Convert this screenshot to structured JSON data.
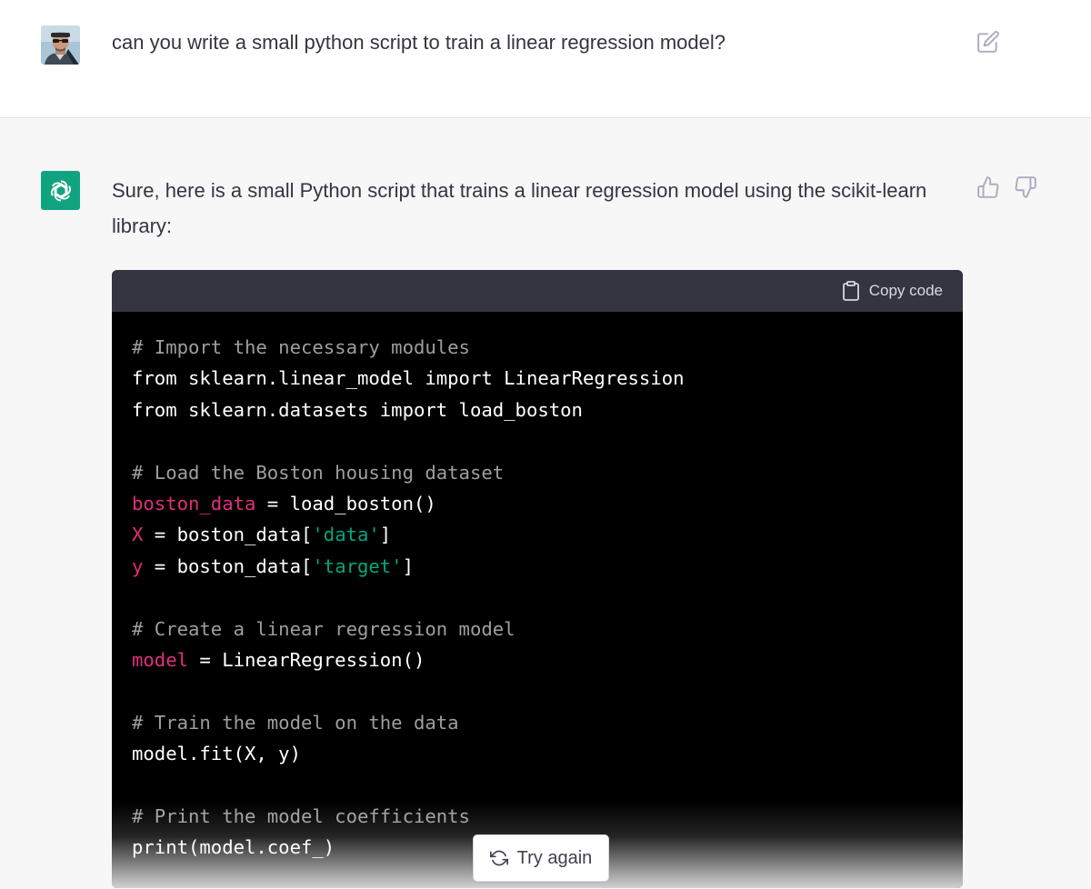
{
  "conversation": {
    "user_message": "can you write a small python script to train a linear regression model?",
    "assistant_intro": "Sure, here is a small Python script that trains a linear regression model using the scikit-learn library:"
  },
  "code_block": {
    "copy_label": "Copy code",
    "lines": [
      [
        {
          "t": "# Import the necessary modules",
          "k": "comment"
        }
      ],
      [
        {
          "t": "from sklearn.linear_model import LinearRegression",
          "k": "plain"
        }
      ],
      [
        {
          "t": "from sklearn.datasets import load_boston",
          "k": "plain"
        }
      ],
      [],
      [
        {
          "t": "# Load the Boston housing dataset",
          "k": "comment"
        }
      ],
      [
        {
          "t": "boston_data",
          "k": "var"
        },
        {
          "t": " = load_boston()",
          "k": "plain"
        }
      ],
      [
        {
          "t": "X",
          "k": "var"
        },
        {
          "t": " = boston_data[",
          "k": "plain"
        },
        {
          "t": "'data'",
          "k": "str"
        },
        {
          "t": "]",
          "k": "plain"
        }
      ],
      [
        {
          "t": "y",
          "k": "var"
        },
        {
          "t": " = boston_data[",
          "k": "plain"
        },
        {
          "t": "'target'",
          "k": "str"
        },
        {
          "t": "]",
          "k": "plain"
        }
      ],
      [],
      [
        {
          "t": "# Create a linear regression model",
          "k": "comment"
        }
      ],
      [
        {
          "t": "model",
          "k": "var"
        },
        {
          "t": " = LinearRegression()",
          "k": "plain"
        }
      ],
      [],
      [
        {
          "t": "# Train the model on the data",
          "k": "comment"
        }
      ],
      [
        {
          "t": "model.fit(X, y)",
          "k": "plain"
        }
      ],
      [],
      [
        {
          "t": "# Print the model coefficients",
          "k": "comment"
        }
      ],
      [
        {
          "t": "print(model.coef_)",
          "k": "plain"
        }
      ]
    ]
  },
  "actions": {
    "try_again_label": "Try again"
  },
  "icons": {
    "edit": "edit-icon",
    "thumbs_up": "thumbs-up-icon",
    "thumbs_down": "thumbs-down-icon",
    "clipboard": "clipboard-icon",
    "refresh": "refresh-icon",
    "openai_logo": "openai-logo-icon"
  },
  "colors": {
    "brand_green": "#10a37f",
    "code_background": "#000000",
    "code_header": "#343541",
    "token_variable": "#df3079",
    "token_string": "#00a67d",
    "token_comment": "#9e9e9e"
  }
}
